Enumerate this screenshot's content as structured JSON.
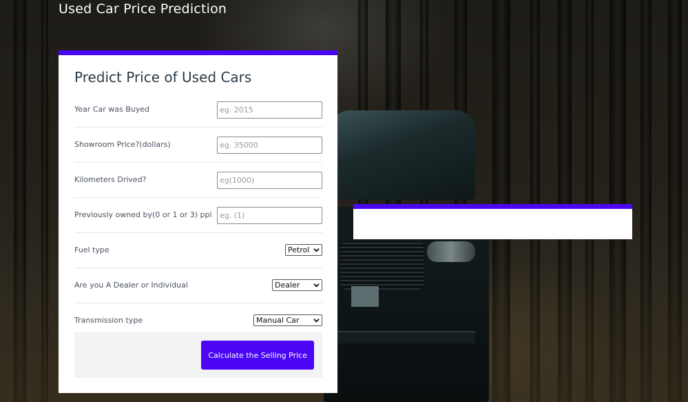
{
  "header": {
    "title": "Used Car Price Prediction"
  },
  "form": {
    "title": "Predict Price of Used Cars",
    "fields": [
      {
        "label": "Year Car was Buyed",
        "placeholder": "eg. 2015",
        "value": ""
      },
      {
        "label": "Showroom Price?(dollars)",
        "placeholder": "eg. 35000",
        "value": ""
      },
      {
        "label": "Kilometers Drived?",
        "placeholder": "eg(1000)",
        "value": ""
      },
      {
        "label": "Previously owned by(0 or 1 or 3) ppl",
        "placeholder": "eg. (1)",
        "value": ""
      }
    ],
    "selects": [
      {
        "label": "Fuel type",
        "selected": "Petrol"
      },
      {
        "label": "Are you A Dealer or Individual",
        "selected": "Dealer"
      },
      {
        "label": "Transmission type",
        "selected": "Manual Car"
      }
    ],
    "submit_label": "Calculate the Selling Price"
  },
  "result": {
    "text": ""
  },
  "colors": {
    "accent": "#4a06f5",
    "card": "#ffffff",
    "panel": "#f3f3f3"
  },
  "icons": {
    "select_arrow": "chevron-down-icon"
  }
}
